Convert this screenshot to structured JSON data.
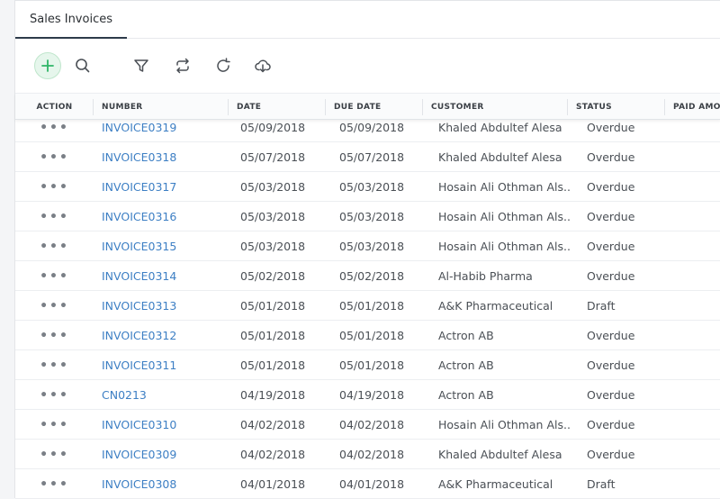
{
  "tab": {
    "label": "Sales Invoices"
  },
  "toolbar": {
    "icons": [
      "plus-icon",
      "search-icon",
      "filter-icon",
      "repeat-icon",
      "refresh-icon",
      "download-icon"
    ],
    "accent": "#2fb567"
  },
  "table": {
    "columns": [
      "ACTION",
      "NUMBER",
      "DATE",
      "DUE DATE",
      "CUSTOMER",
      "STATUS",
      "PAID AMOU"
    ],
    "rows": [
      {
        "number": "INVOICE0319",
        "date": "05/09/2018",
        "due": "05/09/2018",
        "customer": "Khaled Abdultef Alesa",
        "status": "Overdue"
      },
      {
        "number": "INVOICE0318",
        "date": "05/07/2018",
        "due": "05/07/2018",
        "customer": "Khaled Abdultef Alesa",
        "status": "Overdue"
      },
      {
        "number": "INVOICE0317",
        "date": "05/03/2018",
        "due": "05/03/2018",
        "customer": "Hosain Ali Othman Als...",
        "status": "Overdue"
      },
      {
        "number": "INVOICE0316",
        "date": "05/03/2018",
        "due": "05/03/2018",
        "customer": "Hosain Ali Othman Als...",
        "status": "Overdue"
      },
      {
        "number": "INVOICE0315",
        "date": "05/03/2018",
        "due": "05/03/2018",
        "customer": "Hosain Ali Othman Als...",
        "status": "Overdue"
      },
      {
        "number": "INVOICE0314",
        "date": "05/02/2018",
        "due": "05/02/2018",
        "customer": "Al-Habib Pharma",
        "status": "Overdue"
      },
      {
        "number": "INVOICE0313",
        "date": "05/01/2018",
        "due": "05/01/2018",
        "customer": "A&K Pharmaceutical",
        "status": "Draft"
      },
      {
        "number": "INVOICE0312",
        "date": "05/01/2018",
        "due": "05/01/2018",
        "customer": "Actron AB",
        "status": "Overdue"
      },
      {
        "number": "INVOICE0311",
        "date": "05/01/2018",
        "due": "05/01/2018",
        "customer": "Actron AB",
        "status": "Overdue"
      },
      {
        "number": "CN0213",
        "date": "04/19/2018",
        "due": "04/19/2018",
        "customer": "Actron AB",
        "status": "Overdue"
      },
      {
        "number": "INVOICE0310",
        "date": "04/02/2018",
        "due": "04/02/2018",
        "customer": "Hosain Ali Othman Als...",
        "status": "Overdue"
      },
      {
        "number": "INVOICE0309",
        "date": "04/02/2018",
        "due": "04/02/2018",
        "customer": "Khaled Abdultef Alesa",
        "status": "Overdue"
      },
      {
        "number": "INVOICE0308",
        "date": "04/01/2018",
        "due": "04/01/2018",
        "customer": "A&K Pharmaceutical",
        "status": "Draft"
      }
    ]
  }
}
